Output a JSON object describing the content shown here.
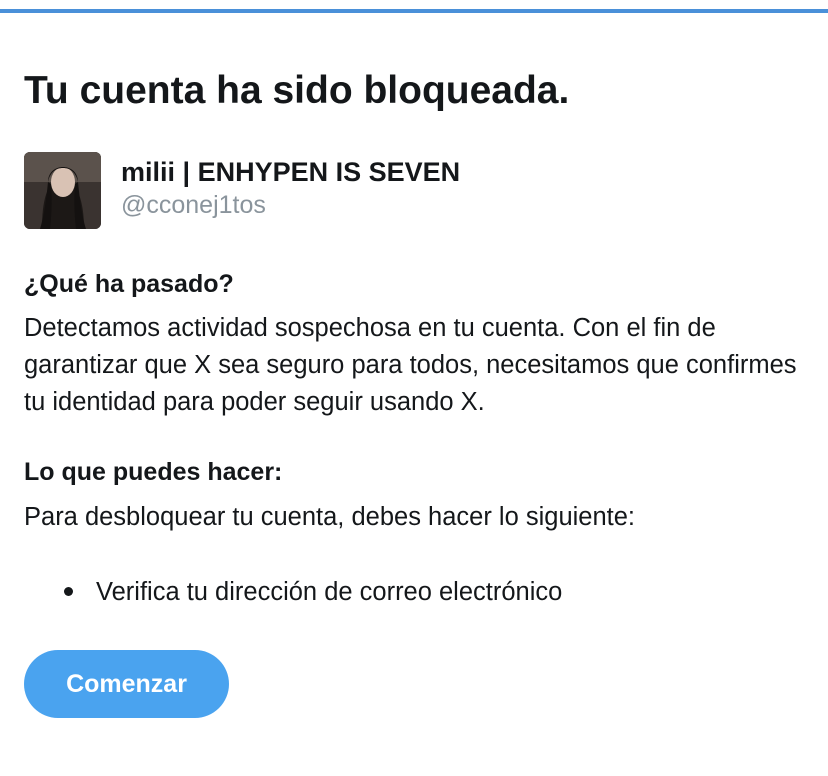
{
  "header": {
    "accent_color": "#4a90d9"
  },
  "page": {
    "title": "Tu cuenta ha sido bloqueada."
  },
  "account": {
    "name": "milii | ENHYPEN IS SEVEN",
    "handle": "@cconej1tos",
    "avatar_icon": "profile-photo"
  },
  "what_happened": {
    "heading": "¿Qué ha pasado?",
    "body": "Detectamos actividad sospechosa en tu cuenta. Con el fin de garantizar que X sea seguro para todos, necesitamos que confirmes tu identidad para poder seguir usando X."
  },
  "what_you_can_do": {
    "heading": "Lo que puedes hacer:",
    "body": "Para desbloquear tu cuenta, debes hacer lo siguiente:",
    "steps": [
      "Verifica tu dirección de correo electrónico"
    ]
  },
  "actions": {
    "start_label": "Comenzar",
    "start_color": "#4aa3ef"
  }
}
